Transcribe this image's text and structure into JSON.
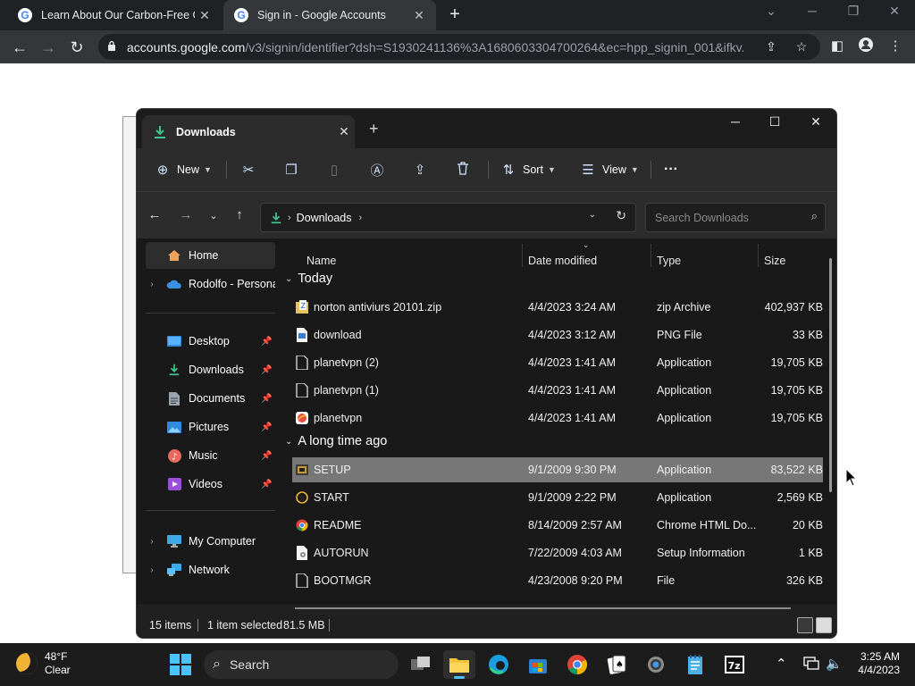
{
  "browser": {
    "tabs": [
      {
        "title": "Learn About Our Carbon-Free Go",
        "active": false
      },
      {
        "title": "Sign in - Google Accounts",
        "active": true
      }
    ],
    "new_tab": "+",
    "url_host": "accounts.google.com",
    "url_path": "/v3/signin/identifier?dsh=S1930241136%3A1680603304700264&ec=hpp_signin_001&ifkv..."
  },
  "explorer": {
    "tab_title": "Downloads",
    "commands": {
      "new": "New",
      "sort": "Sort",
      "view": "View",
      "more": "···"
    },
    "breadcrumb": "Downloads",
    "search_placeholder": "Search Downloads",
    "sidebar": {
      "home": "Home",
      "onedrive": "Rodolfo - Personal",
      "desktop": "Desktop",
      "downloads": "Downloads",
      "documents": "Documents",
      "pictures": "Pictures",
      "music": "Music",
      "videos": "Videos",
      "my_computer": "My Computer",
      "network": "Network"
    },
    "columns": {
      "name": "Name",
      "date": "Date modified",
      "type": "Type",
      "size": "Size"
    },
    "groups": {
      "today": "Today",
      "long_ago": "A long time ago"
    },
    "files": [
      {
        "name": "norton antiviurs 20101.zip",
        "date": "4/4/2023 3:24 AM",
        "type": "zip Archive",
        "size": "402,937 KB",
        "icon": "zip-icon"
      },
      {
        "name": "download",
        "date": "4/4/2023 3:12 AM",
        "type": "PNG File",
        "size": "33 KB",
        "icon": "png-icon"
      },
      {
        "name": "planetvpn (2)",
        "date": "4/4/2023 1:41 AM",
        "type": "Application",
        "size": "19,705 KB",
        "icon": "blank-file-icon"
      },
      {
        "name": "planetvpn (1)",
        "date": "4/4/2023 1:41 AM",
        "type": "Application",
        "size": "19,705 KB",
        "icon": "blank-file-icon"
      },
      {
        "name": "planetvpn",
        "date": "4/4/2023 1:41 AM",
        "type": "Application",
        "size": "19,705 KB",
        "icon": "planetvpn-icon"
      },
      {
        "name": "SETUP",
        "date": "9/1/2009 9:30 PM",
        "type": "Application",
        "size": "83,522 KB",
        "icon": "setup-icon",
        "selected": true
      },
      {
        "name": "START",
        "date": "9/1/2009 2:22 PM",
        "type": "Application",
        "size": "2,569 KB",
        "icon": "start-icon"
      },
      {
        "name": "README",
        "date": "8/14/2009 2:57 AM",
        "type": "Chrome HTML Do...",
        "size": "20 KB",
        "icon": "chrome-html-icon"
      },
      {
        "name": "AUTORUN",
        "date": "7/22/2009 4:03 AM",
        "type": "Setup Information",
        "size": "1 KB",
        "icon": "setup-info-icon"
      },
      {
        "name": "BOOTMGR",
        "date": "4/23/2008 9:20 PM",
        "type": "File",
        "size": "326 KB",
        "icon": "blank-file-icon"
      }
    ],
    "status": {
      "items": "15 items",
      "selected": "1 item selected",
      "size": "81.5 MB"
    }
  },
  "taskbar": {
    "temp": "48°F",
    "condition": "Clear",
    "search_label": "Search",
    "time": "3:25 AM",
    "date": "4/4/2023"
  }
}
